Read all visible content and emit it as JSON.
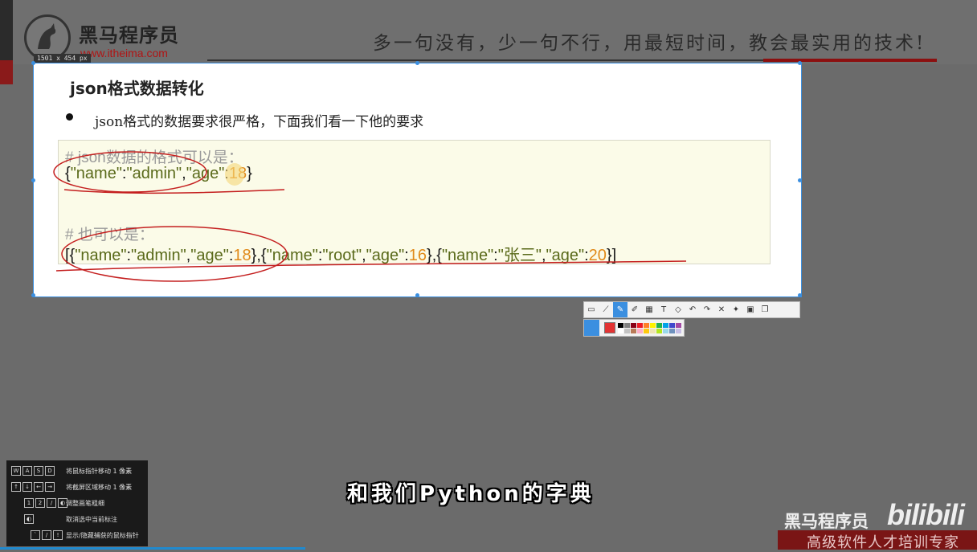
{
  "header": {
    "brand": "黑马程序员",
    "url": "www.itheima.com",
    "slogan": "多一句没有，少一句不行，用最短时间，教会最实用的技术!"
  },
  "selection": {
    "size_label": "1501 x 454  px"
  },
  "slide": {
    "title": "json格式数据转化",
    "bullet": "json格式的数据要求很严格，下面我们看一下他的要求",
    "comment1": "# json数据的格式可以是：",
    "code1": {
      "open": "{",
      "k1": "\"name\"",
      "colon1": ":",
      "v1": "\"admin\"",
      "comma1": ",",
      "k2": "\"age\"",
      "colon2": ":",
      "v2": "18",
      "close": "}"
    },
    "comment2": "# 也可以是：",
    "code2": {
      "p1": "[{",
      "k1": "\"name\"",
      "c1": ":",
      "v1": "\"admin\"",
      "s1": ",",
      "k2": "\"age\"",
      "c2": ":",
      "n1": "18",
      "p2": "},{",
      "k3": "\"name\"",
      "c3": ":",
      "v3": "\"root\"",
      "s2": ",",
      "k4": "\"age\"",
      "c4": ":",
      "n2": "16",
      "p3": "},{",
      "k5": "\"name\"",
      "c5": ":",
      "v5": "\"张三\"",
      "s3": ",",
      "k6": "\"age\"",
      "c6": ":",
      "n3": "20",
      "p4": "}]"
    }
  },
  "toolbar": {
    "icons": [
      "rect-select-icon",
      "line-icon",
      "pencil-icon",
      "marker-icon",
      "mosaic-icon",
      "text-icon",
      "eraser-icon",
      "undo-icon",
      "redo-icon",
      "cancel-icon",
      "pin-icon",
      "save-icon",
      "copy-icon"
    ],
    "glyphs": [
      "▭",
      "⟋",
      "✎",
      "✐",
      "▦",
      "T",
      "◇",
      "↶",
      "↷",
      "✕",
      "✦",
      "▣",
      "❐"
    ],
    "active_index": 2,
    "current_color": "#e33333",
    "colors": [
      "#000000",
      "#7f7f7f",
      "#880015",
      "#ed1c24",
      "#ff7f27",
      "#fff200",
      "#22b14c",
      "#00a2e8",
      "#3f48cc",
      "#a349a4",
      "#ffffff",
      "#c3c3c3",
      "#b97a57",
      "#ffaec9",
      "#ffc90e",
      "#efe4b0",
      "#b5e61d",
      "#99d9ea",
      "#7092be",
      "#c8bfe7"
    ]
  },
  "shortcuts": [
    {
      "keys": [
        "W",
        "A",
        "S",
        "D"
      ],
      "desc": "将鼠标指针移动 1 像素"
    },
    {
      "keys": [
        "↑",
        "↓",
        "←",
        "→"
      ],
      "desc": "将截屏区域移动 1 像素"
    },
    {
      "keys": [
        "1",
        "2",
        "/",
        "◐"
      ],
      "desc": "调整画笔粗细"
    },
    {
      "keys": [
        "◐"
      ],
      "desc": "取消选中当前标注"
    },
    {
      "keys": [
        "`",
        "/",
        "!"
      ],
      "desc": "显示/隐藏捕获的鼠标指针"
    }
  ],
  "subtitle": "和我们Python的字典",
  "watermark": {
    "brand": "黑马程序员",
    "site": "bilibili",
    "tagline": "高级软件人才培训专家"
  },
  "colors": {
    "accent": "#3b8fe0",
    "brand_red": "#8b1010",
    "code_number": "#e08a1a",
    "ink": "#c41e1e"
  }
}
